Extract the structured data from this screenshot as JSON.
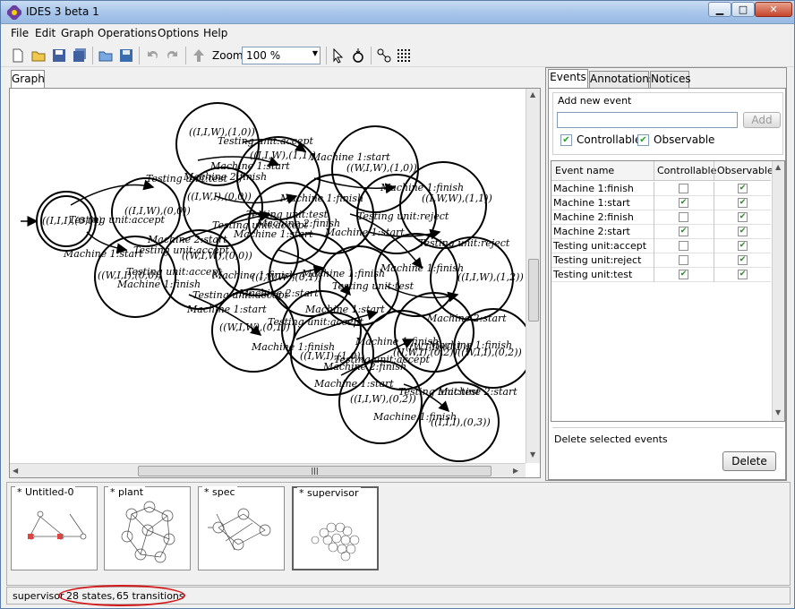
{
  "window": {
    "title": "IDES 3 beta 1"
  },
  "menu": [
    "File",
    "Edit",
    "Graph",
    "Operations",
    "Options",
    "Help"
  ],
  "toolbar": {
    "zoom_label": "Zoom:",
    "zoom_value": "100 %"
  },
  "graph_tab": "Graph",
  "graph": {
    "states": [
      "((I,I,I),(0,0))",
      "((I,I,W),(1,0))",
      "((W,I,W),(1,0))",
      "((I,I,W),(0,0))",
      "((I,W,I),(0,0))",
      "((W,I,I),(0,0))",
      "((I,W,W),(1,1))",
      "((W,I,W),(0,0))",
      "((W,I,W),(0,1))",
      "((I,W,W),(0,1))",
      "((I,I,W),(1,2))",
      "((W,I,I),(0,1))",
      "((I,I,W),(0,2))",
      "((I,W,I),(0,2))",
      "((W,I,I),(0,2))",
      "((I,I,I),(0,3))",
      "((I,W,I),(1,0))",
      "((I,I,W),(1,1))"
    ],
    "edge_labels": [
      "Testing unit:accept",
      "Machine 1:start",
      "Machine 1:finish",
      "Machine 2:start",
      "Machine 2:finish",
      "Testing unit:reject",
      "Testing unit:test"
    ]
  },
  "right_panel": {
    "tabs": [
      "Events",
      "Annotations",
      "Notices"
    ],
    "add_group_label": "Add new event",
    "add_input_value": "",
    "add_button": "Add",
    "controllable_label": "Controllable",
    "observable_label": "Observable",
    "table_headers": [
      "Event name",
      "Controllable",
      "Observable"
    ],
    "events": [
      {
        "name": "Machine 1:finish",
        "controllable": false,
        "observable": true
      },
      {
        "name": "Machine 1:start",
        "controllable": true,
        "observable": true
      },
      {
        "name": "Machine 2:finish",
        "controllable": false,
        "observable": true
      },
      {
        "name": "Machine 2:start",
        "controllable": true,
        "observable": true
      },
      {
        "name": "Testing unit:accept",
        "controllable": false,
        "observable": true
      },
      {
        "name": "Testing unit:reject",
        "controllable": false,
        "observable": true
      },
      {
        "name": "Testing unit:test",
        "controllable": true,
        "observable": true
      }
    ],
    "delete_group_label": "Delete selected events",
    "delete_button": "Delete"
  },
  "thumbnails": [
    "* Untitled-0",
    "* plant",
    "* spec",
    "* supervisor"
  ],
  "status": {
    "model": "supervisor",
    "states": "28 states,",
    "transitions": "65 transitions"
  }
}
